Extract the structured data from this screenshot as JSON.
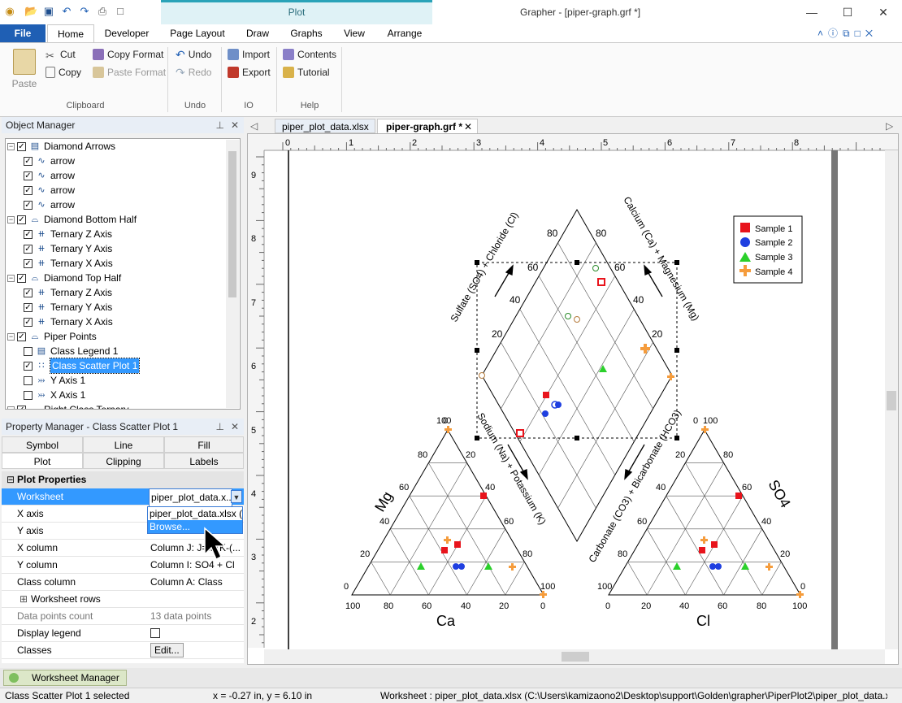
{
  "app": {
    "title": "Grapher - [piper-graph.grf *]",
    "context_group": "Plot"
  },
  "ribbon_tabs": [
    "File",
    "Home",
    "Developer",
    "Page Layout",
    "Draw",
    "Graphs",
    "View",
    "Arrange"
  ],
  "ribbon": {
    "clipboard": {
      "paste": "Paste",
      "cut": "Cut",
      "copy": "Copy",
      "copy_format": "Copy Format",
      "paste_format": "Paste Format",
      "label": "Clipboard"
    },
    "undo": {
      "undo": "Undo",
      "redo": "Redo",
      "label": "Undo"
    },
    "io": {
      "import": "Import",
      "export": "Export",
      "label": "IO"
    },
    "help": {
      "contents": "Contents",
      "tutorial": "Tutorial",
      "label": "Help"
    }
  },
  "object_manager": {
    "title": "Object Manager",
    "items": [
      {
        "label": "Diamond Arrows",
        "level": 0,
        "checked": true,
        "icon": "group-icon"
      },
      {
        "label": "arrow",
        "level": 1,
        "checked": true,
        "icon": "line-icon"
      },
      {
        "label": "arrow",
        "level": 1,
        "checked": true,
        "icon": "line-icon"
      },
      {
        "label": "arrow",
        "level": 1,
        "checked": true,
        "icon": "line-icon"
      },
      {
        "label": "arrow",
        "level": 1,
        "checked": true,
        "icon": "line-icon"
      },
      {
        "label": "Diamond Bottom Half",
        "level": 0,
        "checked": true,
        "icon": "graph-icon"
      },
      {
        "label": "Ternary Z Axis",
        "level": 1,
        "checked": true,
        "icon": "axis-icon"
      },
      {
        "label": "Ternary Y Axis",
        "level": 1,
        "checked": true,
        "icon": "axis-icon"
      },
      {
        "label": "Ternary X Axis",
        "level": 1,
        "checked": true,
        "icon": "axis-icon"
      },
      {
        "label": "Diamond Top Half",
        "level": 0,
        "checked": true,
        "icon": "graph-icon"
      },
      {
        "label": "Ternary Z Axis",
        "level": 1,
        "checked": true,
        "icon": "axis-icon"
      },
      {
        "label": "Ternary Y Axis",
        "level": 1,
        "checked": true,
        "icon": "axis-icon"
      },
      {
        "label": "Ternary X Axis",
        "level": 1,
        "checked": true,
        "icon": "axis-icon"
      },
      {
        "label": "Piper Points",
        "level": 0,
        "checked": true,
        "icon": "graph-icon"
      },
      {
        "label": "Class Legend 1",
        "level": 1,
        "checked": false,
        "icon": "legend-icon"
      },
      {
        "label": "Class Scatter Plot 1",
        "level": 1,
        "checked": true,
        "icon": "scatter-icon",
        "selected": true
      },
      {
        "label": "Y Axis 1",
        "level": 1,
        "checked": false,
        "icon": "y-axis-icon"
      },
      {
        "label": "X Axis 1",
        "level": 1,
        "checked": false,
        "icon": "x-axis-icon"
      },
      {
        "label": "Right Class Ternary",
        "level": 0,
        "checked": true,
        "icon": "graph-icon"
      }
    ]
  },
  "property_manager": {
    "title": "Property Manager - Class Scatter Plot 1",
    "tabs_row1": [
      "Symbol",
      "Line",
      "Fill"
    ],
    "tabs_row2": [
      "Plot",
      "Clipping",
      "Labels"
    ],
    "section": "Plot Properties",
    "rows": [
      {
        "key": "Worksheet",
        "value": "piper_plot_data.x..."
      },
      {
        "key": "X axis",
        "value": "X Axis 1"
      },
      {
        "key": "Y axis",
        "value": "Y Axis 1"
      },
      {
        "key": "X column",
        "value": "Column J: J=IF(K-(..."
      },
      {
        "key": "Y column",
        "value": "Column I: SO4 + Cl"
      },
      {
        "key": "Class column",
        "value": "Column A: Class"
      },
      {
        "key": "Worksheet rows",
        "value": ""
      },
      {
        "key": "Data points count",
        "value": "13 data points"
      },
      {
        "key": "Display legend",
        "value": ""
      },
      {
        "key": "Classes",
        "value": "Edit..."
      }
    ],
    "dropdown": {
      "options": [
        "piper_plot_data.xlsx (C:",
        "Browse..."
      ]
    }
  },
  "document_tabs": [
    "piper_plot_data.xlsx *",
    "piper-graph.grf *"
  ],
  "ruler": {
    "top": [
      "0",
      "1",
      "2",
      "3",
      "4",
      "5",
      "6",
      "7",
      "8"
    ],
    "left": [
      "9",
      "8",
      "7",
      "6",
      "5",
      "4",
      "3",
      "2"
    ]
  },
  "plot": {
    "legend": [
      "Sample 1",
      "Sample 2",
      "Sample 3",
      "Sample 4"
    ],
    "legend_colors": [
      "#e8141c",
      "#1f3fe0",
      "#2bd02b",
      "#f59c3c"
    ],
    "left_triangle": {
      "title_left": "Mg",
      "title_bottom": "Ca",
      "bottom_ticks": [
        "100",
        "80",
        "60",
        "40",
        "20",
        "0"
      ],
      "left_ticks": [
        "0",
        "20",
        "40",
        "60",
        "80",
        "100"
      ],
      "right_ticks": [
        "0",
        "20",
        "40",
        "60",
        "80",
        "100"
      ]
    },
    "right_triangle": {
      "title_right": "SO4",
      "title_bottom": "Cl",
      "bottom_ticks": [
        "0",
        "20",
        "40",
        "60",
        "80",
        "100"
      ],
      "left_ticks": [
        "100",
        "80",
        "60",
        "40",
        "20",
        "0"
      ],
      "right_ticks": [
        "100",
        "80",
        "60",
        "40",
        "20",
        "0"
      ]
    },
    "diamond": {
      "label_ul": "Sulfate (SO4) + Chloride (Cl)",
      "label_ur": "Calcium (Ca) + Magnesium (Mg)",
      "label_ll": "Sodium (Na) + Potassium (K)",
      "label_lr": "Carbonate (CO3) + Bicarbonate (HCO3)",
      "ticks_left": [
        "20",
        "40",
        "60",
        "80"
      ],
      "ticks_right": [
        "80",
        "60",
        "40",
        "20"
      ]
    }
  },
  "bottom": {
    "worksheet_manager": "Worksheet Manager",
    "status_left": "Class Scatter Plot 1 selected",
    "status_coords": "x = -0.27 in, y = 6.10 in",
    "status_worksheet": "Worksheet : piper_plot_data.xlsx (C:\\Users\\kamizaono2\\Desktop\\support\\Golden\\grapher\\PiperPlot2\\piper_plot_data.xlsx)"
  }
}
